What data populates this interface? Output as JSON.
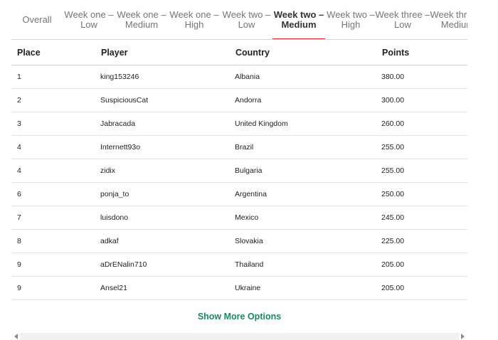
{
  "tabs": [
    {
      "line1": "Overall",
      "line2": "",
      "active": false,
      "width": 72
    },
    {
      "line1": "Week one –",
      "line2": "Low",
      "active": false,
      "width": 74
    },
    {
      "line1": "Week one –",
      "line2": "Medium",
      "active": false,
      "width": 74
    },
    {
      "line1": "Week one –",
      "line2": "High",
      "active": false,
      "width": 74
    },
    {
      "line1": "Week two –",
      "line2": "Low",
      "active": false,
      "width": 73
    },
    {
      "line1": "Week two –",
      "line2": "Medium",
      "active": true,
      "width": 74
    },
    {
      "line1": "Week two –",
      "line2": "High",
      "active": false,
      "width": 72
    },
    {
      "line1": "Week three –",
      "line2": "Low",
      "active": false,
      "width": 74
    },
    {
      "line1": "Week three –",
      "line2": "Medium",
      "active": false,
      "width": 80
    }
  ],
  "table": {
    "headers": {
      "place": "Place",
      "player": "Player",
      "country": "Country",
      "points": "Points"
    },
    "rows": [
      {
        "place": "1",
        "player": "king153246",
        "country": "Albania",
        "points": "380.00"
      },
      {
        "place": "2",
        "player": "SuspiciousCat",
        "country": "Andorra",
        "points": "300.00"
      },
      {
        "place": "3",
        "player": "Jabracada",
        "country": "United Kingdom",
        "points": "260.00"
      },
      {
        "place": "4",
        "player": "Internett93o",
        "country": "Brazil",
        "points": "255.00"
      },
      {
        "place": "4",
        "player": "zidix",
        "country": "Bulgaria",
        "points": "255.00"
      },
      {
        "place": "6",
        "player": "ponja_to",
        "country": "Argentina",
        "points": "250.00"
      },
      {
        "place": "7",
        "player": "luisdono",
        "country": "Mexico",
        "points": "245.00"
      },
      {
        "place": "8",
        "player": "adkaf",
        "country": "Slovakia",
        "points": "225.00"
      },
      {
        "place": "9",
        "player": "aDrENalin710",
        "country": "Thailand",
        "points": "205.00"
      },
      {
        "place": "9",
        "player": "Ansel21",
        "country": "Ukraine",
        "points": "205.00"
      }
    ]
  },
  "show_more_label": "Show More Options",
  "colors": {
    "active_tab_indicator": "#d32f2f",
    "show_more": "#1c8763"
  }
}
